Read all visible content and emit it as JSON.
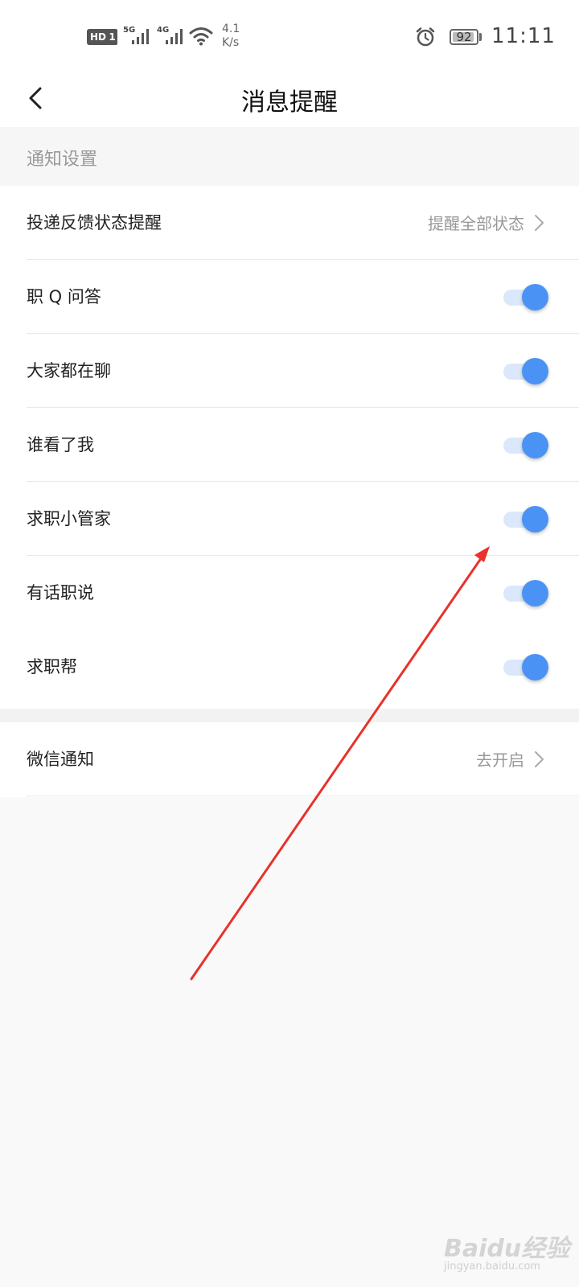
{
  "status_bar": {
    "hd_badge": "HD",
    "sim_badge": "1",
    "network_1": "5G",
    "network_2": "4G",
    "speed_value": "4.1",
    "speed_unit": "K/s",
    "battery": "92",
    "battery_level": 0.92,
    "time": "11:11",
    "icons": [
      "signal-icon",
      "wifi-icon",
      "alarm-icon",
      "battery-icon"
    ]
  },
  "header": {
    "title": "消息提醒",
    "back_icon": "chevron-left-icon"
  },
  "section": {
    "title": "通知设置"
  },
  "notification_rows": [
    {
      "label": "投递反馈状态提醒",
      "value": "提醒全部状态",
      "type": "link"
    },
    {
      "label": "职 Q 问答",
      "type": "toggle",
      "on": true
    },
    {
      "label": "大家都在聊",
      "type": "toggle",
      "on": true
    },
    {
      "label": "谁看了我",
      "type": "toggle",
      "on": true
    },
    {
      "label": "求职小管家",
      "type": "toggle",
      "on": true
    },
    {
      "label": "有话职说",
      "type": "toggle",
      "on": true
    },
    {
      "label": "求职帮",
      "type": "toggle",
      "on": true
    }
  ],
  "wechat_row": {
    "label": "微信通知",
    "value": "去开启",
    "type": "link"
  },
  "colors": {
    "accent": "#4a93f5",
    "track": "#dbe8fb",
    "annotation": "#e8322a"
  },
  "watermark": {
    "main": "Baidu经验",
    "sub": "jingyan.baidu.com"
  }
}
